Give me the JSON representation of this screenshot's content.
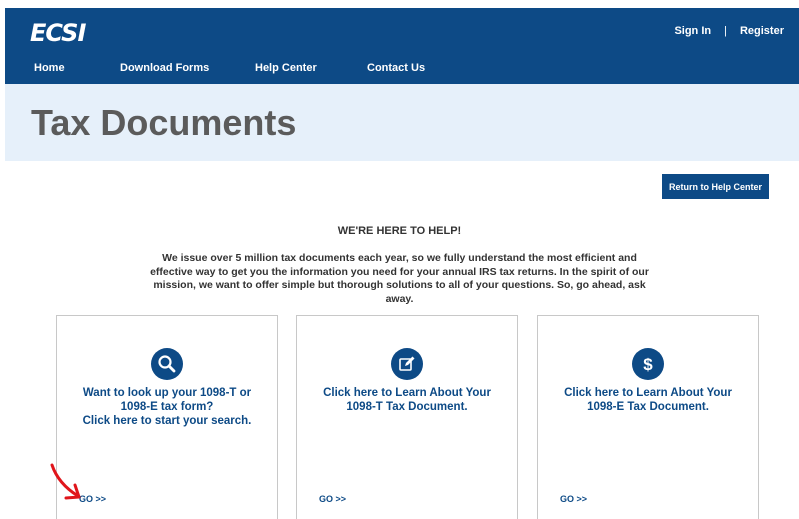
{
  "header": {
    "logo": "ECSI",
    "sign_in": "Sign In",
    "separator": "|",
    "register": "Register",
    "nav": [
      {
        "label": "Home"
      },
      {
        "label": "Download Forms"
      },
      {
        "label": "Help Center"
      },
      {
        "label": "Contact Us"
      }
    ]
  },
  "hero": {
    "title": "Tax Documents"
  },
  "main": {
    "return_button": "Return to Help Center",
    "help_title": "WE'RE HERE TO HELP!",
    "intro": "We issue over 5 million tax documents each year, so we fully understand the most efficient and effective way to get you the information you need for your annual IRS tax returns. In the spirit of our mission, we want to offer simple but thorough solutions to all of your questions. So, go ahead, ask away.",
    "cards": [
      {
        "icon": "search-icon",
        "line1": "Want to look up your 1098-T or",
        "line2": "1098-E tax form?",
        "line3": "Click here to start your search.",
        "go": "GO >>"
      },
      {
        "icon": "edit-icon",
        "line1": "Click here to Learn About Your",
        "line2": "1098-T Tax Document.",
        "line3": "",
        "go": "GO >>"
      },
      {
        "icon": "dollar-icon",
        "line1": "Click here to Learn About Your",
        "line2": "1098-E Tax Document.",
        "line3": "",
        "go": "GO >>"
      }
    ]
  },
  "colors": {
    "brand_blue": "#0d4a86",
    "hero_bg": "#e6f0fa",
    "annotation_red": "#e0151b"
  }
}
